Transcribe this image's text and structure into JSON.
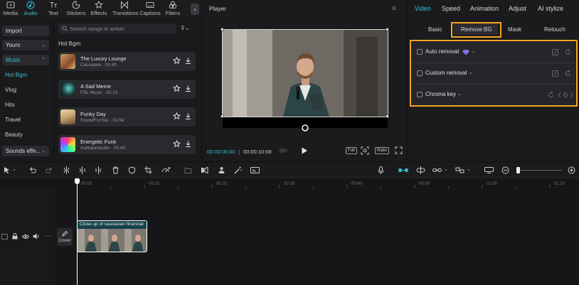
{
  "toolbar": {
    "items": [
      {
        "label": "Media",
        "icon": "media-icon"
      },
      {
        "label": "Audio",
        "icon": "audio-icon",
        "active": true
      },
      {
        "label": "Text",
        "icon": "text-icon"
      },
      {
        "label": "Stickers",
        "icon": "stickers-icon"
      },
      {
        "label": "Effects",
        "icon": "effects-icon"
      },
      {
        "label": "Transitions",
        "icon": "transitions-icon"
      },
      {
        "label": "Captions",
        "icon": "captions-icon"
      },
      {
        "label": "Filters",
        "icon": "filters-icon"
      }
    ],
    "more": "›"
  },
  "leftnav": {
    "import": "Import",
    "yours": "Yours",
    "music": "Music",
    "items": [
      "Hot Bgm",
      "Vlog",
      "Hits",
      "Travel",
      "Beauty"
    ],
    "sounds": "Sounds effe..."
  },
  "songs": {
    "search_placeholder": "Search songs or artists",
    "heading": "Hot Bgm",
    "list": [
      {
        "name": "The Luxury Lounge",
        "meta": "Casiopeia · 01:40"
      },
      {
        "name": "A Sad Meme",
        "meta": "FSL Music · 02:13"
      },
      {
        "name": "Funky Day",
        "meta": "SoundForYou · 01:54"
      },
      {
        "name": "Energetic Funk",
        "meta": "AurbannAudio · 01:40"
      }
    ]
  },
  "player": {
    "title": "Player",
    "current_time": "00:00:00:00",
    "separator": "|",
    "total_time": "00:00:10:08",
    "full_label": "Full",
    "ratio_label": "Ratio"
  },
  "right": {
    "tabs": [
      "Video",
      "Speed",
      "Animation",
      "Adjust",
      "AI stylize"
    ],
    "subtabs": [
      "Basic",
      "Remove BG",
      "Mask",
      "Retouch"
    ],
    "options": [
      "Auto removal",
      "Custom removal",
      "Chroma key"
    ]
  },
  "ruler": {
    "ticks": [
      "00:00",
      "00:10",
      "00:20",
      "00:30",
      "00:40",
      "00:50",
      "01:00",
      "01:10"
    ]
  },
  "timeline": {
    "cover_label": "Cover",
    "clip_label": "Close up of caucasian financial"
  },
  "colors": {
    "accent": "#2fc3d3",
    "highlight": "#f5a623"
  }
}
